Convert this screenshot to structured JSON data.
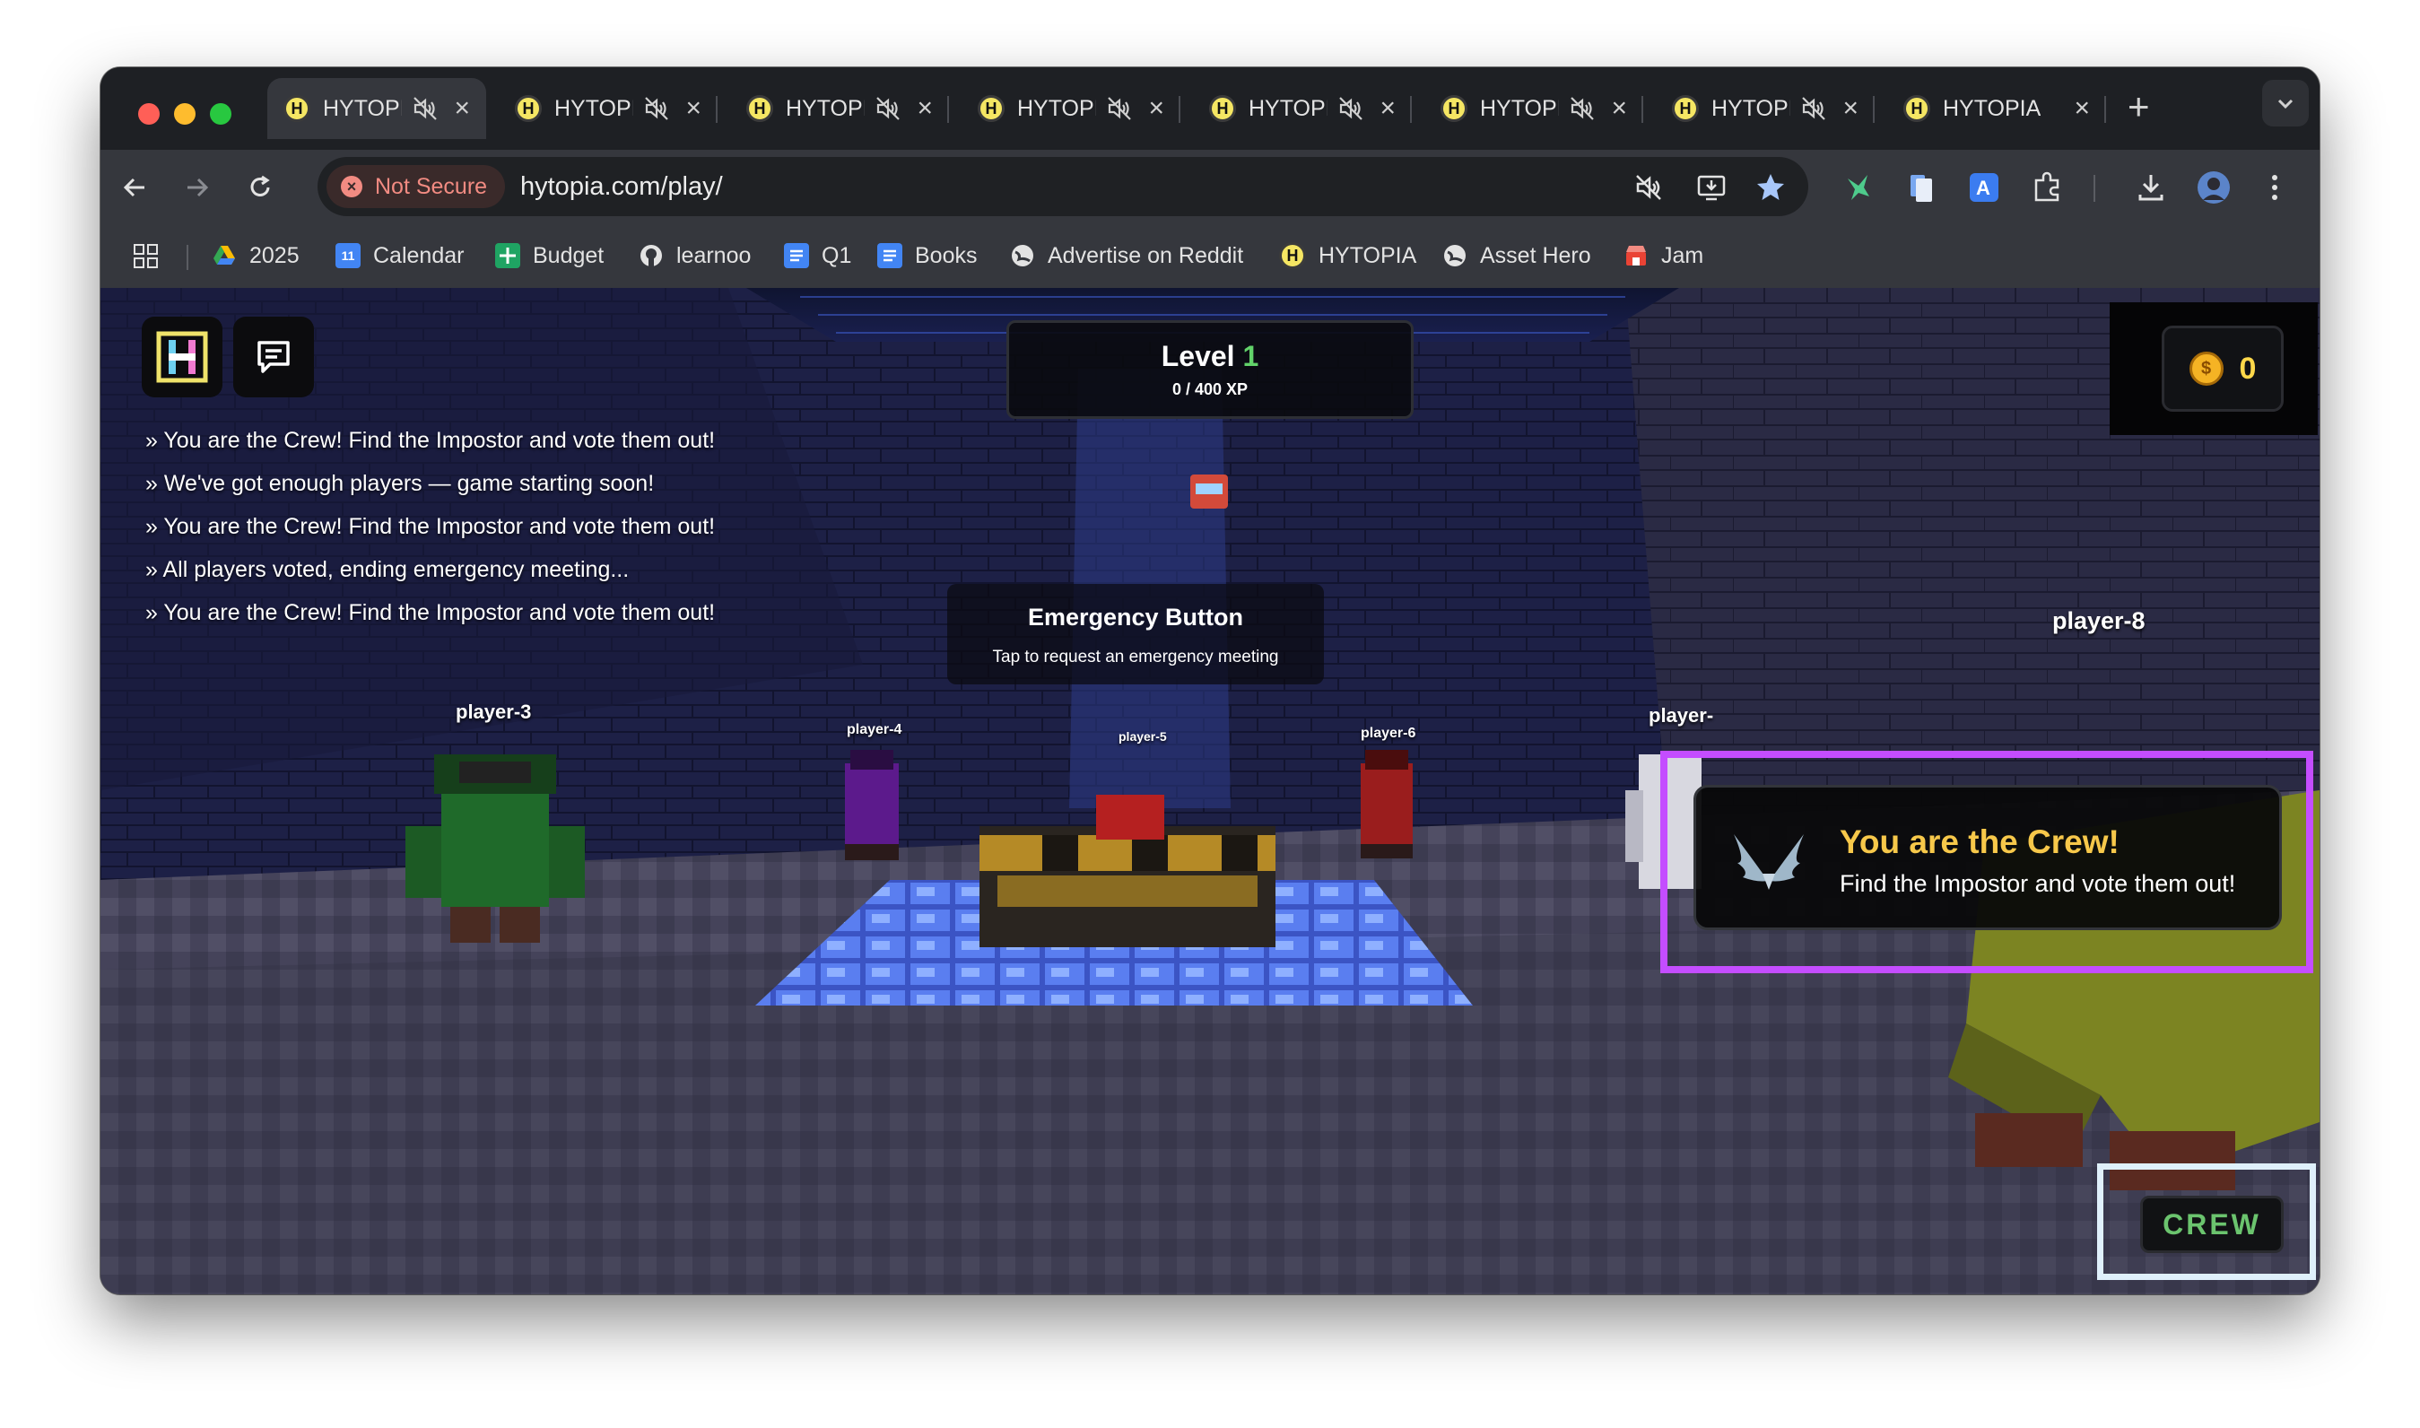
{
  "browser": {
    "tabs": [
      {
        "title": "HYTOPIA",
        "muted": true,
        "active": true
      },
      {
        "title": "HYTOPIA",
        "muted": true,
        "active": false
      },
      {
        "title": "HYTOPIA",
        "muted": true,
        "active": false
      },
      {
        "title": "HYTOPIA",
        "muted": true,
        "active": false
      },
      {
        "title": "HYTOPIA",
        "muted": true,
        "active": false
      },
      {
        "title": "HYTOPIA",
        "muted": true,
        "active": false
      },
      {
        "title": "HYTOPIA",
        "muted": true,
        "active": false
      },
      {
        "title": "HYTOPIA",
        "muted": false,
        "active": false
      }
    ],
    "new_tab_label": "+",
    "security_label": "Not Secure",
    "url": "hytopia.com/play/",
    "bookmarks": [
      {
        "label": "2025",
        "icon": "google-drive-icon"
      },
      {
        "label": "Calendar",
        "icon": "calendar-icon"
      },
      {
        "label": "Budget",
        "icon": "sheets-icon"
      },
      {
        "label": "learnoo",
        "icon": "github-icon"
      },
      {
        "label": "Q1",
        "icon": "docs-icon"
      },
      {
        "label": "Books",
        "icon": "docs-icon"
      },
      {
        "label": "Advertise on Reddit",
        "icon": "globe-icon"
      },
      {
        "label": "HYTOPIA",
        "icon": "hytopia-icon"
      },
      {
        "label": "Asset Hero",
        "icon": "globe-icon"
      },
      {
        "label": "Jam",
        "icon": "store-icon"
      }
    ],
    "calendar_day": "11"
  },
  "game": {
    "chat_messages": [
      "» You are the Crew! Find the Impostor and vote them out!",
      "» We've got enough players — game starting soon!",
      "» You are the Crew! Find the Impostor and vote them out!",
      "» All players voted, ending emergency meeting...",
      "» You are the Crew! Find the Impostor and vote them out!"
    ],
    "level": {
      "label": "Level",
      "value": "1",
      "xp": "0 / 400 XP"
    },
    "coins": "0",
    "coin_symbol": "$",
    "emergency": {
      "title": "Emergency Button",
      "subtitle": "Tap to request an emergency meeting"
    },
    "players": {
      "p3": "player-3",
      "p4": "player-4",
      "p5": "player-5",
      "p6": "player-6",
      "p7": "player-",
      "p8": "player-8"
    },
    "role_notice": {
      "title": "You are the Crew!",
      "message": "Find the Impostor and vote them out!"
    },
    "role_badge": "CREW",
    "colors": {
      "accent_level": "#62d36a",
      "notice_title": "#f7c84a",
      "crew_badge": "#6bc46e",
      "highlight_notice": "#c44dff",
      "highlight_badge": "#dff0fb"
    }
  }
}
